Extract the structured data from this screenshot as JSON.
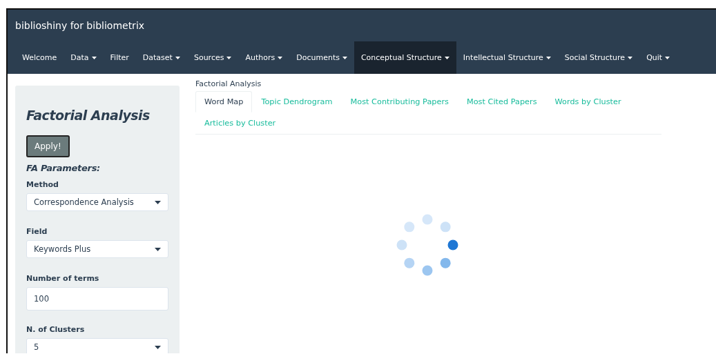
{
  "window": {
    "title": "biblioshiny for bibliometrix"
  },
  "nav": [
    {
      "label": "Welcome",
      "dropdown": false,
      "selected": false
    },
    {
      "label": "Data",
      "dropdown": true,
      "selected": false
    },
    {
      "label": "Filter",
      "dropdown": false,
      "selected": false
    },
    {
      "label": "Dataset",
      "dropdown": true,
      "selected": false
    },
    {
      "label": "Sources",
      "dropdown": true,
      "selected": false
    },
    {
      "label": "Authors",
      "dropdown": true,
      "selected": false
    },
    {
      "label": "Documents",
      "dropdown": true,
      "selected": false
    },
    {
      "label": "Conceptual Structure",
      "dropdown": true,
      "selected": true
    },
    {
      "label": "Intellectual Structure",
      "dropdown": true,
      "selected": false
    },
    {
      "label": "Social Structure",
      "dropdown": true,
      "selected": false
    },
    {
      "label": "Quit",
      "dropdown": true,
      "selected": false
    }
  ],
  "sidebar": {
    "heading": "Factorial Analysis",
    "apply_button": "Apply!",
    "section": "FA Parameters:",
    "fields": [
      {
        "label": "Method",
        "kind": "select",
        "value": "Correspondence Analysis"
      },
      {
        "label": "Field",
        "kind": "select",
        "value": "Keywords Plus"
      },
      {
        "label": "Number of terms",
        "kind": "number",
        "value": "100"
      },
      {
        "label": "N. of Clusters",
        "kind": "select",
        "value": "5"
      }
    ]
  },
  "main": {
    "caption": "Factorial Analysis",
    "tabs": [
      {
        "label": "Word Map",
        "selected": true
      },
      {
        "label": "Topic Dendrogram",
        "selected": false
      },
      {
        "label": "Most Contributing Papers",
        "selected": false
      },
      {
        "label": "Most Cited Papers",
        "selected": false
      },
      {
        "label": "Words by Cluster",
        "selected": false
      },
      {
        "label": "Articles by Cluster",
        "selected": false
      }
    ]
  }
}
